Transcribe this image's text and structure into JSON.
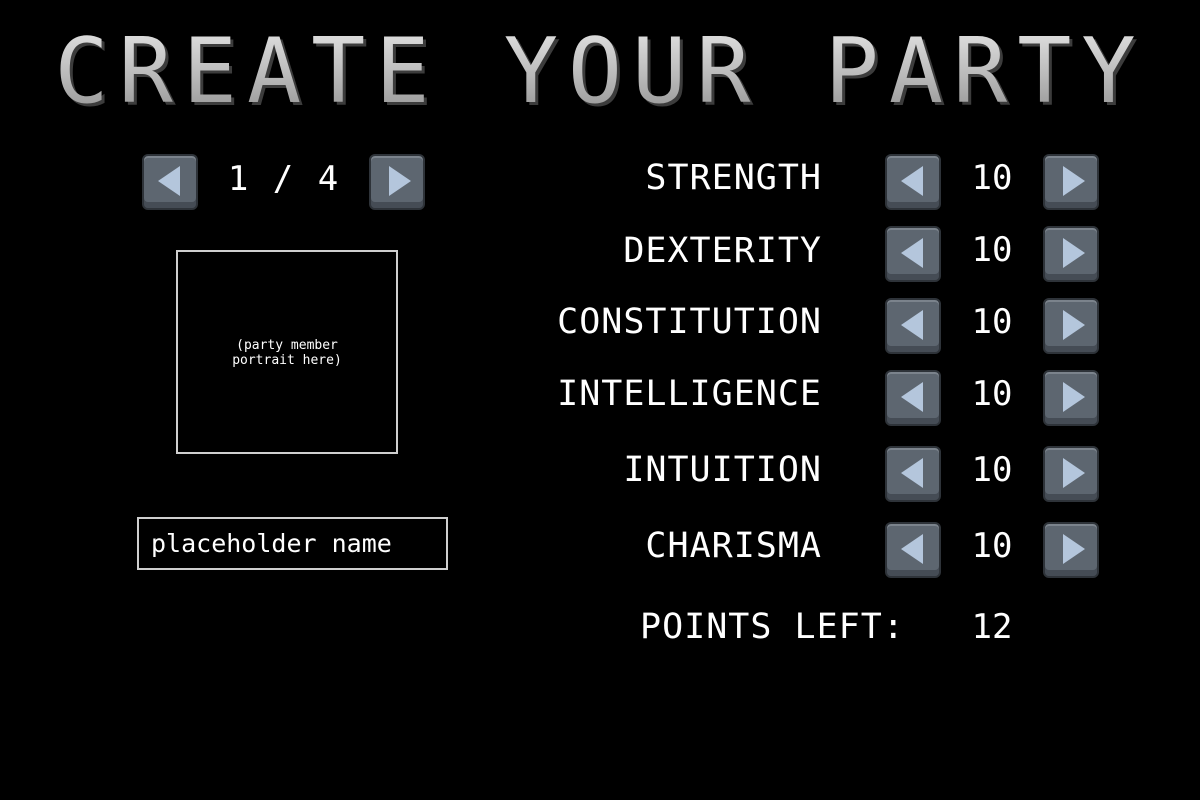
{
  "title": "CREATE YOUR PARTY",
  "party": {
    "pager_text": "1 / 4",
    "prev_icon": "chevron-left-icon",
    "next_icon": "chevron-right-icon"
  },
  "portrait": {
    "placeholder_text": "(party member\nportrait here)"
  },
  "name_field": {
    "placeholder": "placeholder name",
    "value": ""
  },
  "stats": [
    {
      "label": "STRENGTH",
      "value": "10"
    },
    {
      "label": "DEXTERITY",
      "value": "10"
    },
    {
      "label": "CONSTITUTION",
      "value": "10"
    },
    {
      "label": "INTELLIGENCE",
      "value": "10"
    },
    {
      "label": "INTUITION",
      "value": "10"
    },
    {
      "label": "CHARISMA",
      "value": "10"
    }
  ],
  "points": {
    "label": "POINTS LEFT:",
    "value": "12"
  },
  "colors": {
    "background": "#000000",
    "button": "#5d6670",
    "arrow": "#b4c6dc",
    "text": "#ffffff"
  }
}
